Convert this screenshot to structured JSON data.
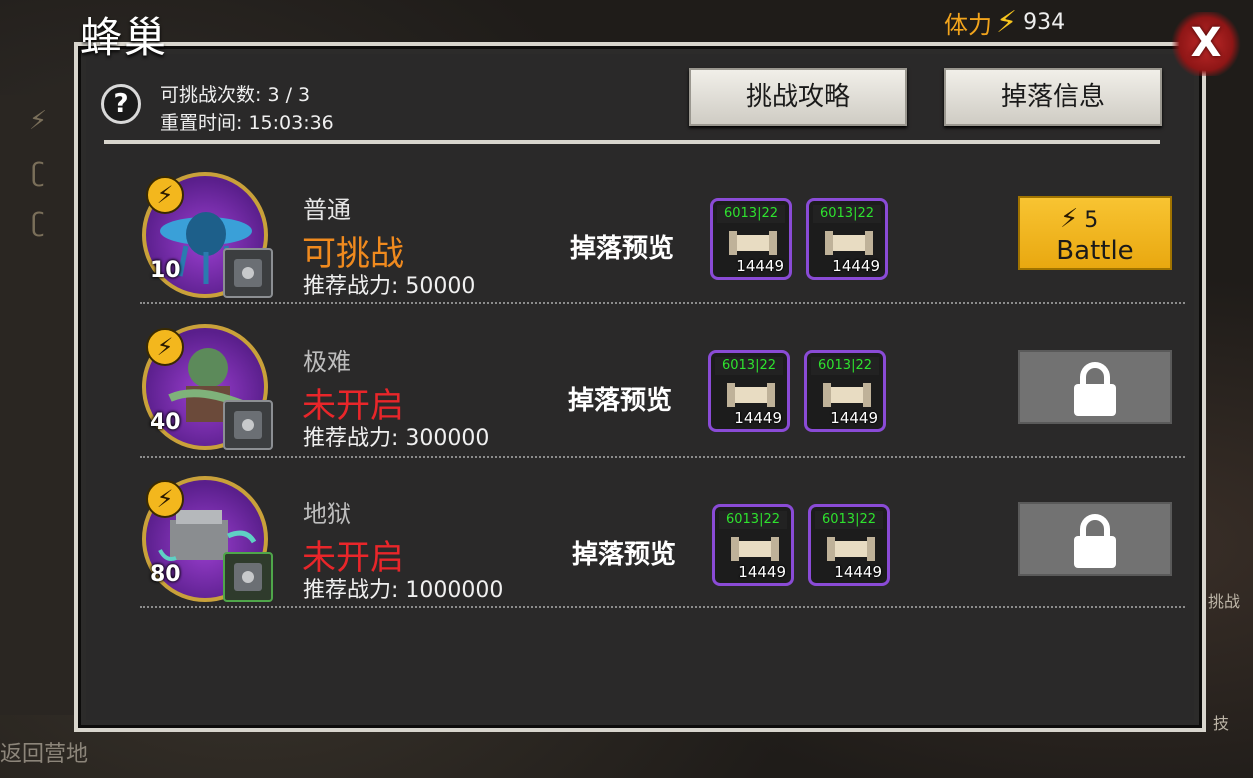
{
  "title": "蜂巢",
  "stamina": {
    "label": "体力",
    "value": "934"
  },
  "close_label": "X",
  "header": {
    "attempts": "可挑战次数: 3 / 3",
    "reset_time": "重置时间: 15:03:36",
    "guide_button": "挑战攻略",
    "drop_info_button": "掉落信息"
  },
  "background": {
    "bottom_left": "返回营地",
    "right_1": "挑战",
    "right_2": "技"
  },
  "rows": [
    {
      "level": "10",
      "difficulty": "普通",
      "status": "可挑战",
      "power": "推荐战力: 50000",
      "drop_label": "掉落预览",
      "drops": [
        {
          "code": "6013|22",
          "count": "14449"
        },
        {
          "code": "6013|22",
          "count": "14449"
        }
      ],
      "action": {
        "type": "battle",
        "cost": "5",
        "label": "Battle"
      }
    },
    {
      "level": "40",
      "difficulty": "极难",
      "status": "未开启",
      "power": "推荐战力: 300000",
      "drop_label": "掉落预览",
      "drops": [
        {
          "code": "6013|22",
          "count": "14449"
        },
        {
          "code": "6013|22",
          "count": "14449"
        }
      ],
      "action": {
        "type": "locked"
      }
    },
    {
      "level": "80",
      "difficulty": "地狱",
      "status": "未开启",
      "power": "推荐战力: 1000000",
      "drop_label": "掉落预览",
      "drops": [
        {
          "code": "6013|22",
          "count": "14449"
        },
        {
          "code": "6013|22",
          "count": "14449"
        }
      ],
      "action": {
        "type": "locked"
      }
    }
  ],
  "colors": {
    "status_available": "#f08a1e",
    "status_locked": "#e9262a",
    "battle_button": "#f5b820",
    "drop_border": "#8a4bd6",
    "stamina_label": "#f2a41c"
  },
  "icons": {
    "help": "question-icon",
    "stamina": "lightning-icon",
    "close": "close-icon",
    "locked": "lock-icon"
  }
}
